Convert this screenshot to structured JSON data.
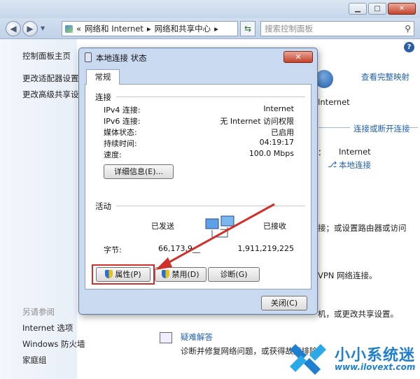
{
  "window": {
    "breadcrumb_prefix": "«",
    "breadcrumb": [
      "网络和 Internet",
      "网络和共享中心"
    ],
    "search_placeholder": "搜索控制面板"
  },
  "leftnav": {
    "items": [
      "控制面板主页",
      "更改适配器设置",
      "更改高级共享设"
    ],
    "see_also_title": "另请参阅",
    "see_also": [
      "Internet 选项",
      "Windows 防火墙",
      "家庭组"
    ]
  },
  "background": {
    "view_full_map": "查看完整映射",
    "internet_label": "Internet",
    "connect_disconnect": "连接或断开连接",
    "access_type_label": "Internet",
    "local_connection_link": "本地连接",
    "text_router": "接；或设置路由器或访问",
    "text_vpn": "VPN 网络连接。",
    "text_share": "机，或更改共享设置。",
    "troubleshoot_link": "疑难解答",
    "troubleshoot_desc": "诊断并修复网络问题，或获得故障排除"
  },
  "dialog": {
    "title": "本地连接 状态",
    "tab": "常规",
    "connection_group": "连接",
    "rows": [
      {
        "label": "IPv4 连接:",
        "value": "Internet"
      },
      {
        "label": "IPv6 连接:",
        "value": "无 Internet 访问权限"
      },
      {
        "label": "媒体状态:",
        "value": "已启用"
      },
      {
        "label": "持续时间:",
        "value": "04:19:17"
      },
      {
        "label": "速度:",
        "value": "100.0 Mbps"
      }
    ],
    "details_button": "详细信息(E)...",
    "activity_group": "活动",
    "sent_label": "已发送",
    "received_label": "已接收",
    "bytes_label": "字节:",
    "bytes_sent": "66,173,9__",
    "bytes_received": "1,911,219,225",
    "properties_button": "属性(P)",
    "disable_button": "禁用(D)",
    "diagnose_button": "诊断(G)",
    "close_button": "关闭(C)"
  },
  "watermark": {
    "brand": "小小系统迷",
    "url": "www.ilovext.com"
  }
}
